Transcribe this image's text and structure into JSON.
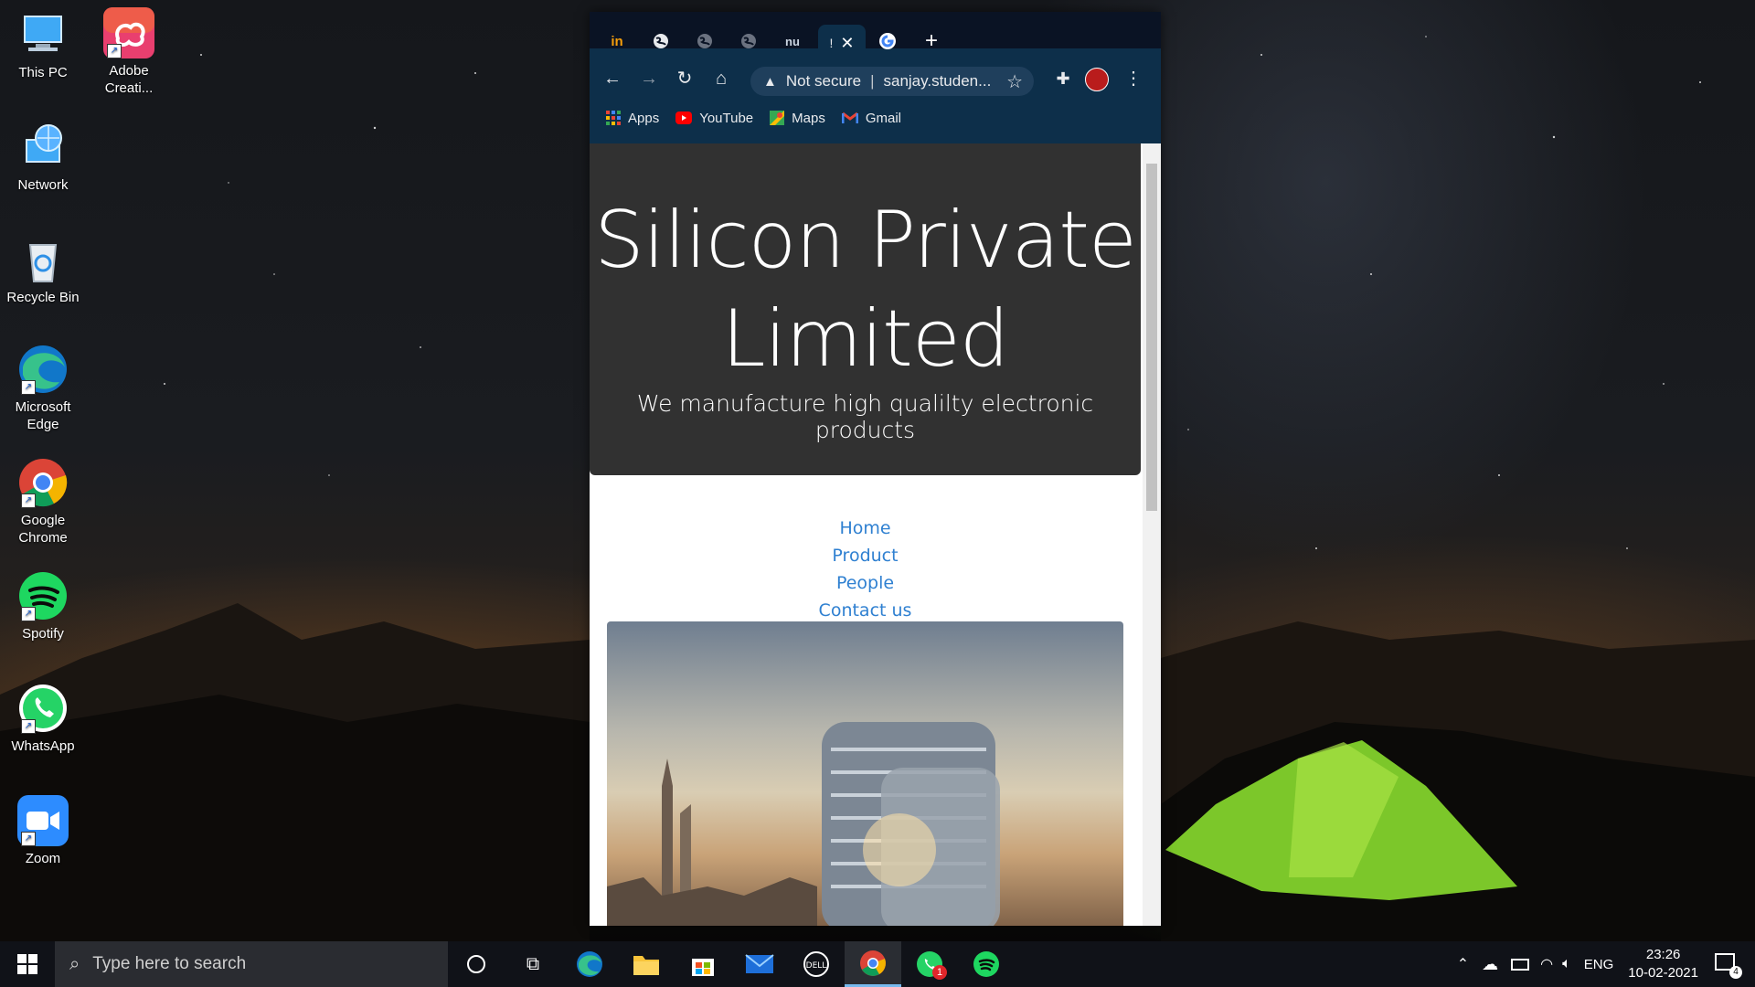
{
  "desktop": {
    "icons": [
      {
        "label": "This PC"
      },
      {
        "label": "Adobe Creati..."
      },
      {
        "label": "Network"
      },
      {
        "label": "Recycle Bin"
      },
      {
        "label": "Microsoft Edge"
      },
      {
        "label": "Google Chrome"
      },
      {
        "label": "Spotify"
      },
      {
        "label": "WhatsApp"
      },
      {
        "label": "Zoom"
      }
    ]
  },
  "browser": {
    "tabs": [
      {
        "icon": "in-icon",
        "text": "in"
      },
      {
        "icon": "globe-icon"
      },
      {
        "icon": "globe-icon"
      },
      {
        "icon": "globe-icon"
      },
      {
        "icon": "nu-icon",
        "text": "nu"
      },
      {
        "icon": "active-tab",
        "text": "!"
      },
      {
        "icon": "google-icon"
      }
    ],
    "omnibox": {
      "security": "Not secure",
      "url": "sanjay.studen..."
    },
    "bookmarks": [
      {
        "label": "Apps"
      },
      {
        "label": "YouTube"
      },
      {
        "label": "Maps"
      },
      {
        "label": "Gmail"
      }
    ]
  },
  "page": {
    "title": "Silicon Private Limited",
    "tagline": "We manufacture high qualilty electronic products",
    "nav": [
      "Home",
      "Product",
      "People",
      "Contact us"
    ]
  },
  "taskbar": {
    "search_placeholder": "Type here to search",
    "language": "ENG",
    "time": "23:26",
    "date": "10-02-2021",
    "whatsapp_badge": "1",
    "notifications_count": "4"
  }
}
